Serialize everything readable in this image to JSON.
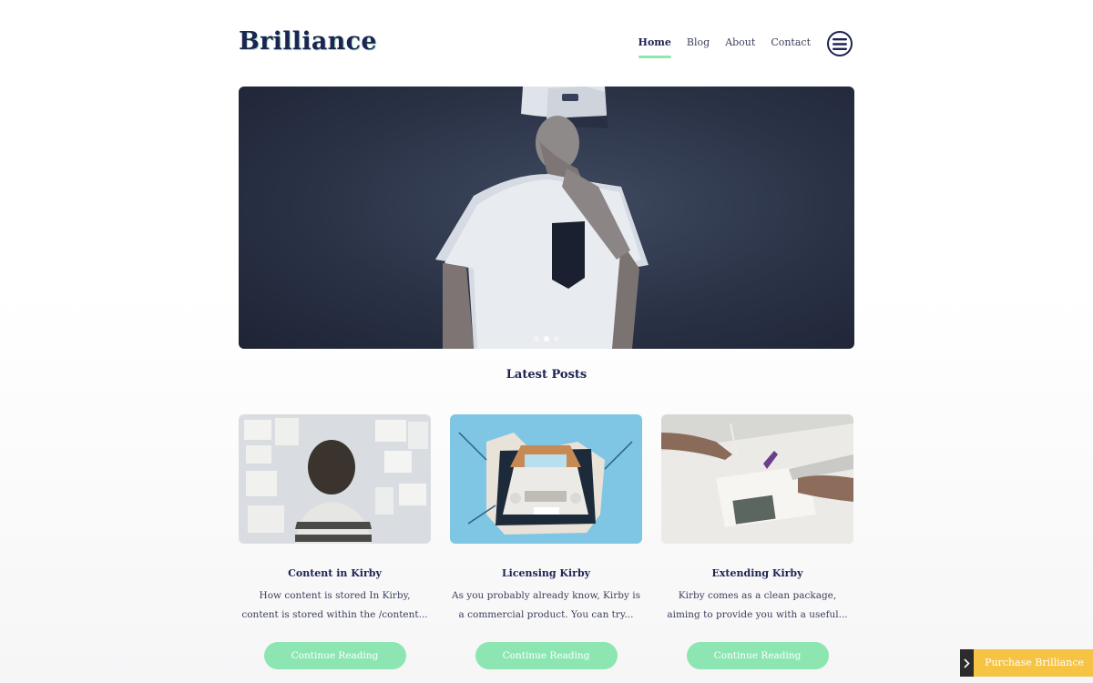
{
  "site": {
    "logo": "Brilliance"
  },
  "nav": {
    "items": [
      {
        "label": "Home",
        "active": true
      },
      {
        "label": "Blog",
        "active": false
      },
      {
        "label": "About",
        "active": false
      },
      {
        "label": "Contact",
        "active": false
      }
    ],
    "menu_icon": "hamburger-menu-icon"
  },
  "hero": {
    "slides": 3,
    "active_slide": 2
  },
  "latest": {
    "title": "Latest Posts",
    "posts": [
      {
        "title": "Content in Kirby",
        "excerpt": "How content is stored In Kirby, content is stored within the /content...",
        "button": "Continue Reading"
      },
      {
        "title": "Licensing Kirby",
        "excerpt": "As you probably already know, Kirby is a commercial product. You can try...",
        "button": "Continue Reading"
      },
      {
        "title": "Extending Kirby",
        "excerpt": "Kirby comes as a clean package, aiming to provide you with a useful...",
        "button": "Continue Reading"
      }
    ]
  },
  "purchase": {
    "label": "Purchase Brilliance",
    "icon": "chevron-right-icon"
  },
  "colors": {
    "accent": "#8de6b1",
    "brand": "#1d2452",
    "purchase": "#f6c342"
  }
}
